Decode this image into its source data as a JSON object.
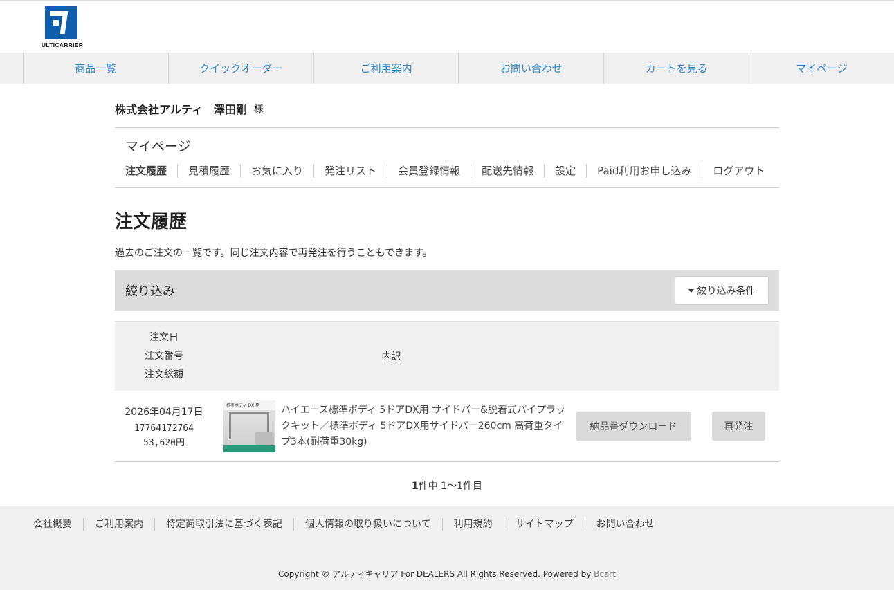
{
  "brand": {
    "logo_text": "ULTICARRIER",
    "color": "#0f5fae"
  },
  "global_nav": [
    "商品一覧",
    "クイックオーダー",
    "ご利用案内",
    "お問い合わせ",
    "カートを見る",
    "マイページ"
  ],
  "user": {
    "name": "株式会社アルティ　澤田剛",
    "suffix": "様"
  },
  "mypage": {
    "title": "マイページ",
    "tabs": [
      "注文履歴",
      "見積履歴",
      "お気に入り",
      "発注リスト",
      "会員登録情報",
      "配送先情報",
      "設定",
      "Paid利用お申し込み",
      "ログアウト"
    ],
    "active_tab": "注文履歴"
  },
  "orders_page": {
    "title": "注文履歴",
    "description": "過去のご注文の一覧です。同じ注文内容で再発注を行うこともできます。",
    "filter": {
      "title": "絞り込み",
      "button_label": "絞り込み条件"
    },
    "table": {
      "headers": {
        "date": "注文日",
        "number": "注文番号",
        "total": "注文総額",
        "detail": "内訳"
      },
      "rows": [
        {
          "date": "2026年04月17日",
          "number": "17764172764",
          "total": "53,620円",
          "thumbnail_label": "標準ボディ DX 用",
          "product": "ハイエース標準ボディ 5ドアDX用 サイドバー&脱着式パイプラックキット／標準ボディ 5ドアDX用サイドバー260cm 高荷重タイプ3本(耐荷重30kg)",
          "download_label": "納品書ダウンロード",
          "reorder_label": "再発注"
        }
      ]
    },
    "pager": {
      "count": "1",
      "text": "件中 1〜1件目"
    }
  },
  "footer": {
    "links": [
      "会社概要",
      "ご利用案内",
      "特定商取引法に基づく表記",
      "個人情報の取り扱いについて",
      "利用規約",
      "サイトマップ",
      "お問い合わせ"
    ],
    "copyright": "Copyright © アルティキャリア For DEALERS All Rights Reserved. Powered by",
    "powered_by": "Bcart"
  }
}
